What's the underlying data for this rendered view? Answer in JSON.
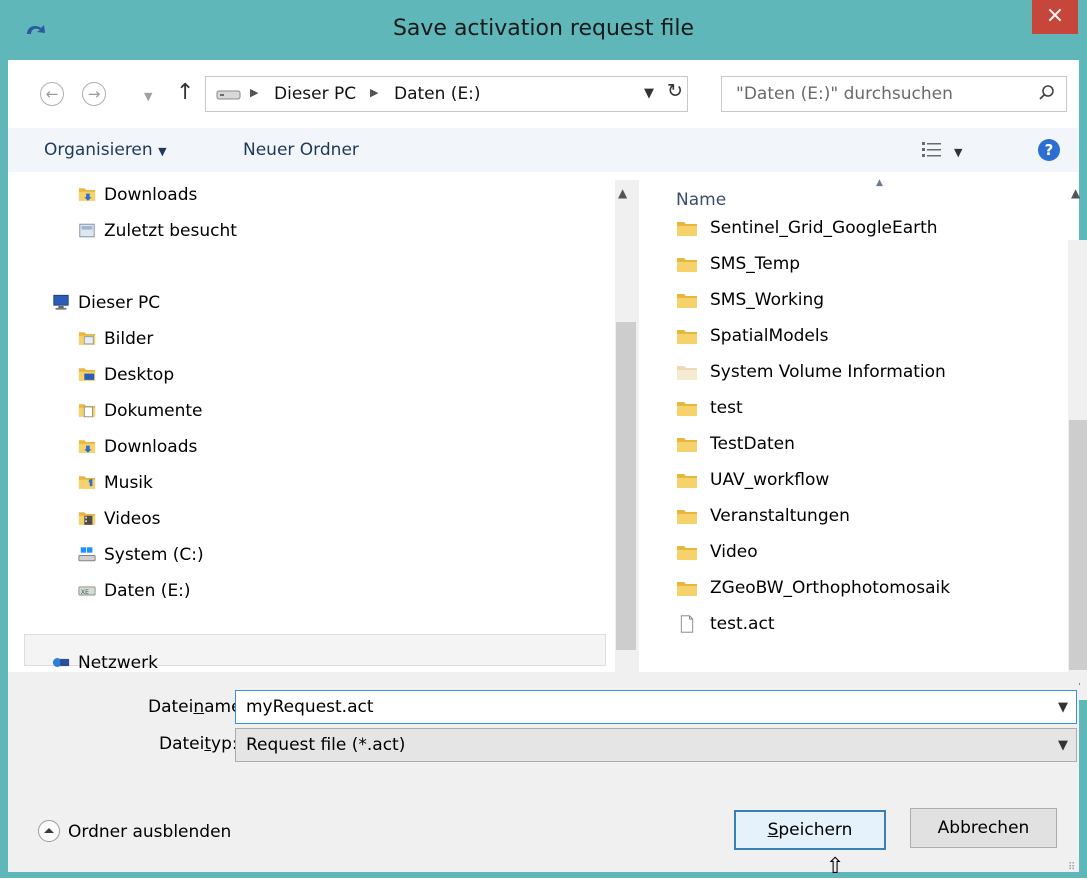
{
  "window": {
    "title": "Save activation request file",
    "close_glyph": "×",
    "accent": "#5fb7b9",
    "close_color": "#c7463c"
  },
  "address_bar": {
    "crumbs": [
      "Dieser PC",
      "Daten (E:)"
    ],
    "search_placeholder": "\"Daten (E:)\" durchsuchen"
  },
  "toolbar": {
    "organize": "Organisieren",
    "new_folder": "Neuer Ordner",
    "help": "?"
  },
  "nav_pane": {
    "items": [
      {
        "label": "Downloads",
        "icon": "downloads-folder-icon"
      },
      {
        "label": "Zuletzt besucht",
        "icon": "recent-places-icon"
      },
      {
        "label": "Dieser PC",
        "icon": "computer-icon"
      },
      {
        "label": "Bilder",
        "icon": "pictures-folder-icon"
      },
      {
        "label": "Desktop",
        "icon": "desktop-folder-icon"
      },
      {
        "label": "Dokumente",
        "icon": "documents-folder-icon"
      },
      {
        "label": "Downloads",
        "icon": "downloads-folder-icon"
      },
      {
        "label": "Musik",
        "icon": "music-folder-icon"
      },
      {
        "label": "Videos",
        "icon": "videos-folder-icon"
      },
      {
        "label": "System (C:)",
        "icon": "system-drive-icon"
      },
      {
        "label": "Daten (E:)",
        "icon": "data-drive-icon",
        "selected": true
      },
      {
        "label": "Netzwerk",
        "icon": "network-icon"
      }
    ]
  },
  "file_list": {
    "column_header": "Name",
    "sort": "ascending",
    "items": [
      {
        "name": "Sentinel_Grid_GoogleEarth",
        "type": "folder"
      },
      {
        "name": "SMS_Temp",
        "type": "folder"
      },
      {
        "name": "SMS_Working",
        "type": "folder"
      },
      {
        "name": "SpatialModels",
        "type": "folder"
      },
      {
        "name": "System Volume Information",
        "type": "folder-hidden"
      },
      {
        "name": "test",
        "type": "folder"
      },
      {
        "name": "TestDaten",
        "type": "folder"
      },
      {
        "name": "UAV_workflow",
        "type": "folder"
      },
      {
        "name": "Veranstaltungen",
        "type": "folder"
      },
      {
        "name": "Video",
        "type": "folder"
      },
      {
        "name": "ZGeoBW_Orthophotomosaik",
        "type": "folder"
      },
      {
        "name": "test.act",
        "type": "file"
      }
    ]
  },
  "save_form": {
    "filename_label_pre": "Datei",
    "filename_label_u": "n",
    "filename_label_post": "ame:",
    "filename_value": "myRequest.act",
    "filetype_label_pre": "Datei",
    "filetype_label_u": "t",
    "filetype_label_post": "yp:",
    "filetype_value": "Request file (*.act)",
    "hide_folders": "Ordner ausblenden",
    "save_u": "S",
    "save_rest": "peichern",
    "cancel": "Abbrechen"
  }
}
